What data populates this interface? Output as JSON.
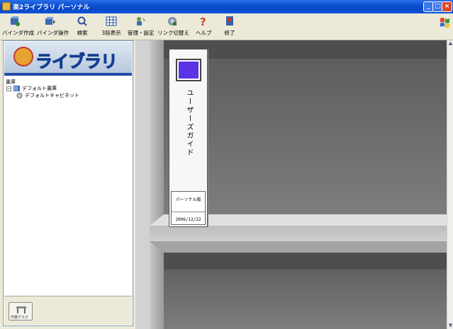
{
  "window": {
    "title": "楽2ライブラリ パーソナル",
    "controls": {
      "minimize": "_",
      "maximize": "□",
      "close": "×"
    }
  },
  "toolbar": {
    "items": [
      {
        "label": "バインダ作成",
        "icon": "binder-create-icon"
      },
      {
        "label": "バインダ操作",
        "icon": "binder-operate-icon"
      },
      {
        "label": "検索",
        "icon": "search-icon"
      },
      {
        "label": "3段表示",
        "icon": "three-tier-icon"
      },
      {
        "label": "管理・設定",
        "icon": "settings-icon"
      },
      {
        "label": "リンク切替え",
        "icon": "link-switch-icon"
      },
      {
        "label": "ヘルプ",
        "icon": "help-icon"
      },
      {
        "label": "終了",
        "icon": "exit-icon"
      }
    ]
  },
  "sidebar": {
    "logo_text": "ライブラリ",
    "tree": {
      "root": "書庫",
      "library": "デフォルト書庫",
      "cabinet": "デフォルトキャビネット"
    },
    "desk_button_label": "作業デスク"
  },
  "binder": {
    "title": "ユーザーズガイド",
    "edition": "パーソナル版",
    "date": "2006/12/22",
    "window_color": "#5a34e6"
  },
  "colors": {
    "titlebar": "#0b4fd1",
    "accent": "#2548a8",
    "shelf": "#6f6f6f"
  }
}
